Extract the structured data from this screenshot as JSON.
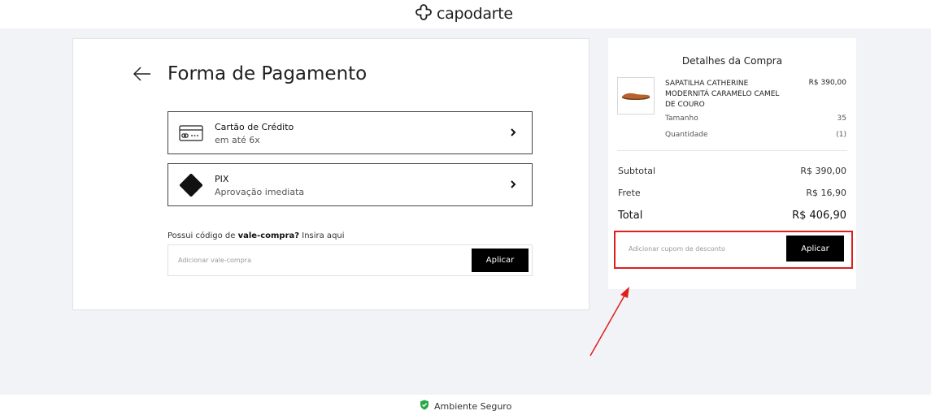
{
  "header": {
    "logo_text": "capodarte",
    "logo_icon": "capodarte-clover-logo"
  },
  "payment": {
    "title": "Forma de Pagamento",
    "back_icon": "arrow-left-icon",
    "options": [
      {
        "title": "Cartão de Crédito",
        "subtitle": "em até 6x",
        "icon": "credit-card-icon"
      },
      {
        "title": "PIX",
        "subtitle": "Aprovação imediata",
        "icon": "pix-icon"
      }
    ],
    "voucher": {
      "label_prefix": "Possui código de ",
      "label_bold": "vale-compra?",
      "label_suffix": " Insira aqui",
      "placeholder": "Adicionar vale-compra",
      "button_label": "Aplicar"
    }
  },
  "summary": {
    "title": "Detalhes da Compra",
    "product": {
      "name": "SAPATILHA CATHERINE MODERNITÁ CARAMELO CAMEL DE COURO",
      "price": "R$ 390,00",
      "size_label": "Tamanho",
      "size_value": "35",
      "qty_label": "Quantidade",
      "qty_value": "(1)",
      "thumb_icon": "shoe-thumbnail"
    },
    "subtotal_label": "Subtotal",
    "subtotal_value": "R$ 390,00",
    "shipping_label": "Frete",
    "shipping_value": "R$ 16,90",
    "total_label": "Total",
    "total_value": "R$ 406,90",
    "coupon_placeholder": "Adicionar cupom de desconto",
    "coupon_button": "Aplicar"
  },
  "footer": {
    "secure_label": "Ambiente Seguro",
    "secure_icon": "shield-check-icon"
  },
  "colors": {
    "accent_black": "#000000",
    "highlight_red": "#e01e1e",
    "secure_green": "#27a845"
  }
}
